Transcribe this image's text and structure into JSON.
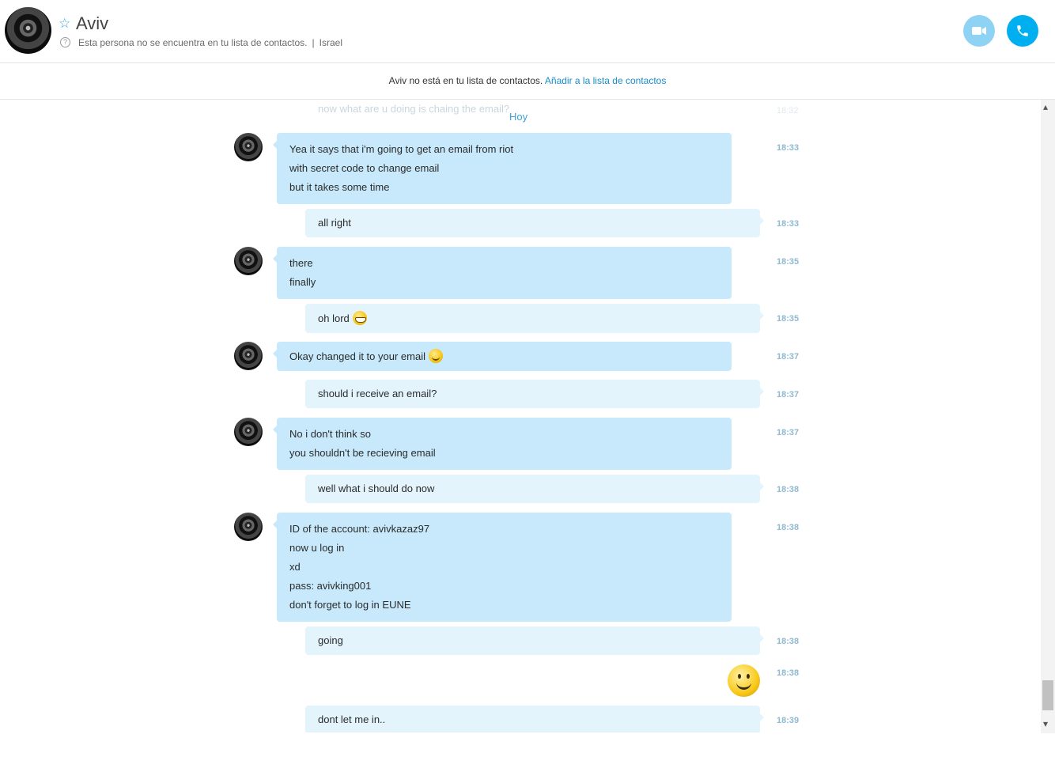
{
  "header": {
    "title": "Aviv",
    "status": "Esta persona no se encuentra en tu lista de contactos.",
    "location": "Israel",
    "separator": "|"
  },
  "banner": {
    "text": "Aviv no está en tu lista de contactos.",
    "link": "Añadir a la lista de contactos"
  },
  "chat": {
    "ghost_text": "now what are u doing is chaing the email?",
    "ghost_time": "18:32",
    "day_label": "Hoy",
    "messages": [
      {
        "lines": [
          "Yea it says that i'm going to get an email from riot",
          "with secret code to change email",
          "but it takes some time"
        ],
        "time": "18:33"
      },
      {
        "lines": [
          "all right"
        ],
        "time": "18:33"
      },
      {
        "lines": [
          "there",
          "finally"
        ],
        "time": "18:35"
      },
      {
        "lines": [
          "oh lord"
        ],
        "time": "18:35",
        "emoticon": "grin-emoticon"
      },
      {
        "lines": [
          "Okay changed it to your email"
        ],
        "time": "18:37",
        "emoticon": "smile-emoticon"
      },
      {
        "lines": [
          "should i receive an email?"
        ],
        "time": "18:37"
      },
      {
        "lines": [
          "No i don't think so",
          "you shouldn't be recieving email"
        ],
        "time": "18:37"
      },
      {
        "lines": [
          "well what i should do now"
        ],
        "time": "18:38"
      },
      {
        "lines": [
          "ID of the account: avivkazaz97",
          "now u log in",
          "xd",
          "pass: avivking001",
          "don't forget to log in EUNE"
        ],
        "time": "18:38"
      },
      {
        "lines": [
          "going"
        ],
        "time": "18:38"
      },
      {
        "lines": [],
        "time": "18:38",
        "emoticon": "big-smile-emoticon"
      },
      {
        "lines": [
          "dont let me in.."
        ],
        "time": "18:39"
      }
    ]
  },
  "icons": [
    "star-icon",
    "help-icon",
    "video-call-icon",
    "phone-icon",
    "scroll-up-icon",
    "scroll-down-icon"
  ],
  "colors": {
    "accent": "#00aff0",
    "incoming_bubble": "#c7e9fb",
    "outgoing_bubble": "#e3f4fc",
    "link": "#1a8dc8"
  }
}
